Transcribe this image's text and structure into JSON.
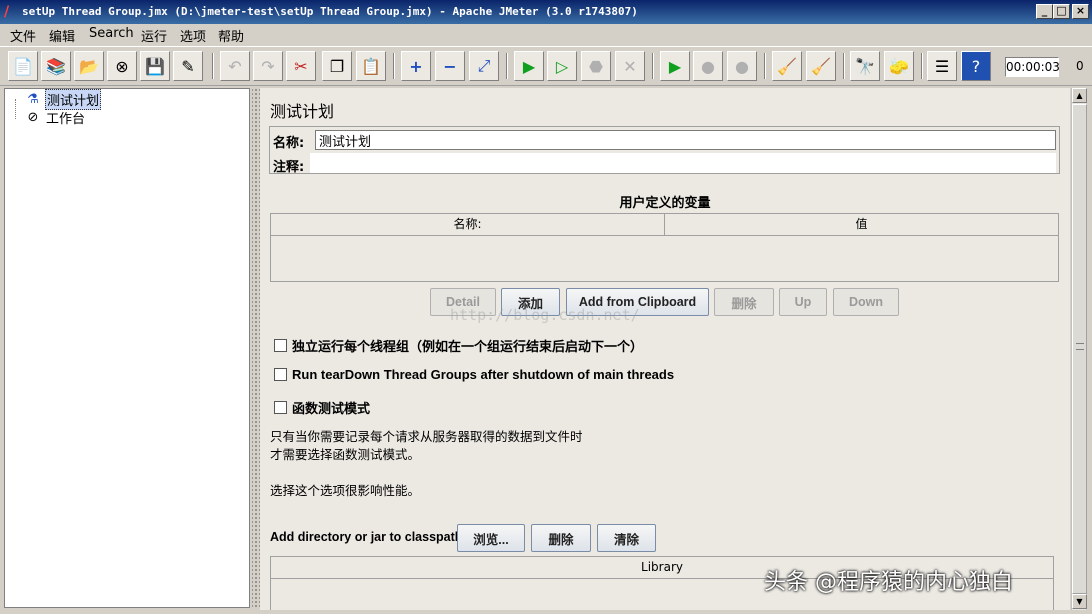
{
  "window": {
    "title": "setUp Thread Group.jmx (D:\\jmeter-test\\setUp Thread Group.jmx) - Apache JMeter (3.0 r1743807)",
    "minimize": "_",
    "maximize": "□",
    "close": "×"
  },
  "menu": [
    "文件",
    "编辑",
    "Search",
    "运行",
    "选项",
    "帮助"
  ],
  "toolbar": {
    "timer": "00:00:03",
    "error_count": "0"
  },
  "tree": {
    "items": [
      {
        "label": "测试计划",
        "icon": "test-plan-icon",
        "selected": true
      },
      {
        "label": "工作台",
        "icon": "workbench-icon",
        "selected": false
      }
    ]
  },
  "panel": {
    "title": "测试计划",
    "name_label": "名称:",
    "name_value": "测试计划",
    "comment_label": "注释:",
    "comment_value": "",
    "vars_title": "用户定义的变量",
    "vars_columns": [
      "名称:",
      "值"
    ],
    "buttons": {
      "detail": "Detail",
      "add": "添加",
      "add_clipboard": "Add from Clipboard",
      "delete": "删除",
      "up": "Up",
      "down": "Down"
    },
    "watermark": "http://blog.csdn.net/",
    "options": {
      "functional_opt": "独立运行每个线程组（例如在一个组运行结束后启动下一个）",
      "teardown_opt": "Run tearDown Thread Groups after shutdown of main threads",
      "functional_mode": "函数测试模式"
    },
    "notes": {
      "line1": "只有当你需要记录每个请求从服务器取得的数据到文件时",
      "line2": "才需要选择函数测试模式。",
      "line3": "选择这个选项很影响性能。"
    },
    "classpath": {
      "label": "Add directory or jar to classpath",
      "browse": "浏览...",
      "delete": "删除",
      "clear": "清除",
      "library_col": "Library"
    }
  },
  "signature": "头条 @程序猿的内心独白"
}
